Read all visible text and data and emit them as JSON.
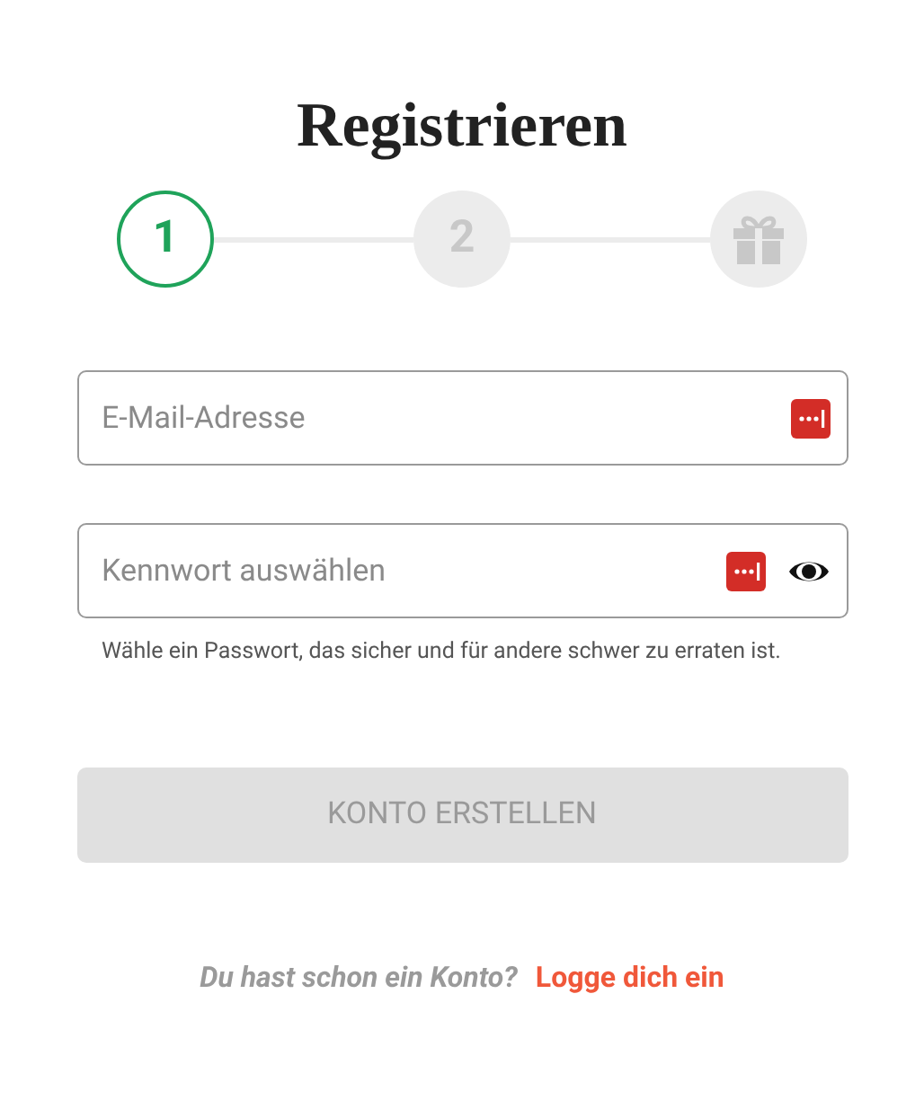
{
  "title": "Registrieren",
  "steps": [
    {
      "kind": "number",
      "label": "1",
      "selected": true
    },
    {
      "kind": "number",
      "label": "2",
      "selected": false
    },
    {
      "kind": "gift",
      "selected": false
    }
  ],
  "fields": [
    {
      "placeholder": "E-Mail-Adresse",
      "password_toggle": false
    },
    {
      "placeholder": "Kennwort auswählen",
      "password_toggle": true,
      "hint": "Wähle ein Passwort, das sicher und für andere schwer zu erraten ist."
    }
  ],
  "submit": {
    "label": "KONTO ERSTELLEN",
    "disabled": true
  },
  "footer": {
    "text": "Du hast schon ein Konto?",
    "link": "Logge dich ein"
  }
}
